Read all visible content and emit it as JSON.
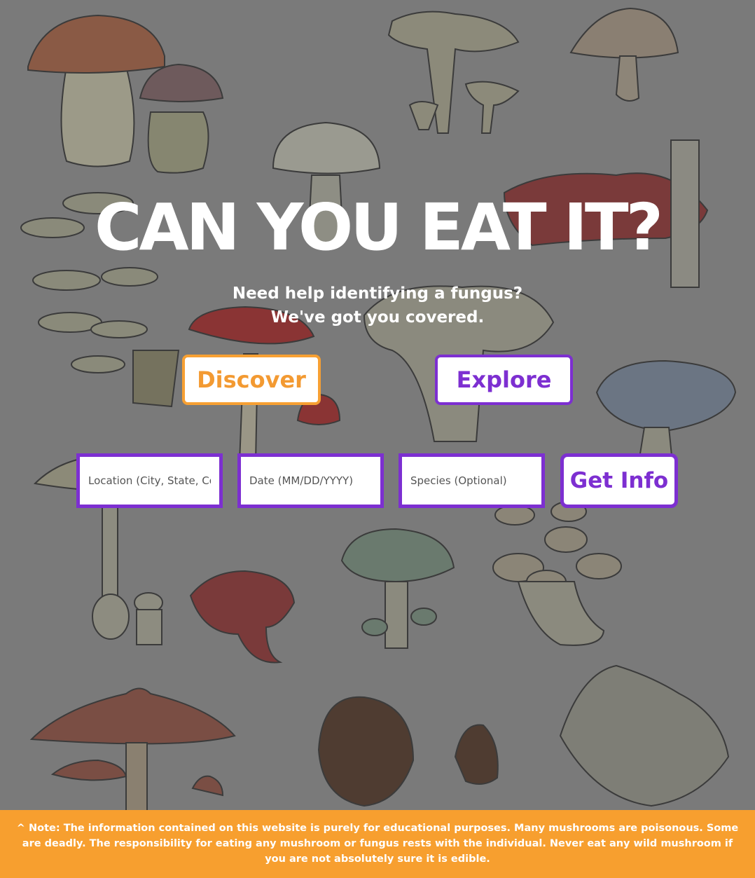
{
  "hero": {
    "title": "CAN YOU EAT IT?",
    "subtitle_line1": "Need help identifying a fungus?",
    "subtitle_line2": "We've got you covered."
  },
  "actions": {
    "discover_label": "Discover",
    "explore_label": "Explore"
  },
  "search": {
    "location_placeholder": "Location (City, State, Country)",
    "date_placeholder": "Date (MM/DD/YYYY)",
    "species_placeholder": "Species (Optional)",
    "submit_label": "Get Info"
  },
  "footer": {
    "note": "^ Note: The information contained on this website is purely for educational purposes. Many mushrooms are poisonous. Some are deadly. The responsibility for eating any mushroom or fungus rests with the individual. Never eat any wild mushroom if you are not absolutely sure it is edible."
  },
  "colors": {
    "overlay": "#7a7a7a",
    "orange_accent": "#f7a033",
    "purple_accent": "#7d2fd1",
    "footer_bg": "#f79f2f"
  }
}
